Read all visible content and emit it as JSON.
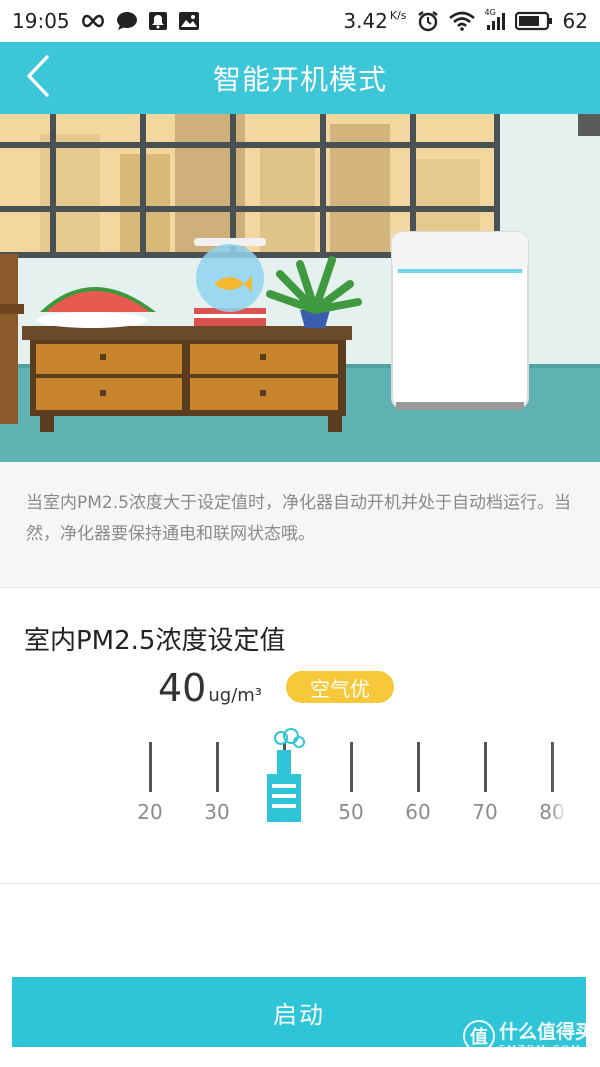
{
  "statusbar": {
    "time": "19:05",
    "net_speed": "3.42",
    "net_speed_unit": "K/s",
    "network_type": "4G",
    "battery": "62",
    "left_icons": [
      "infinity-icon",
      "chat-bubble-icon",
      "notification-bell-icon",
      "image-icon"
    ],
    "right_icons": [
      "alarm-clock-icon",
      "wifi-icon",
      "cellular-signal-icon",
      "battery-icon"
    ]
  },
  "header": {
    "title": "智能开机模式",
    "back_icon": "chevron-left-icon",
    "color": "#3cc7d8"
  },
  "illustration": {
    "subject": "room-with-air-purifier"
  },
  "description": {
    "text": "当室内PM2.5浓度大于设定值时，净化器自动开机并处于自动档运行。当然，净化器要保持通电和联网状态哦。"
  },
  "setting": {
    "title": "室内PM2.5浓度设定值",
    "value": "40",
    "unit": "ug/m³",
    "air_quality_label": "空气优",
    "air_quality_color": "#f7c93a",
    "scale": [
      "20",
      "30",
      "40",
      "50",
      "60",
      "70",
      "80"
    ],
    "selected_value": 40,
    "handle_icon": "factory-chimney-icon",
    "handle_color": "#2ec5d9"
  },
  "footer": {
    "start_label": "启动",
    "button_color": "#2ec5d9"
  },
  "watermark": {
    "main": "什么值得买",
    "sub": "SMZDM.COM",
    "badge": "值"
  }
}
